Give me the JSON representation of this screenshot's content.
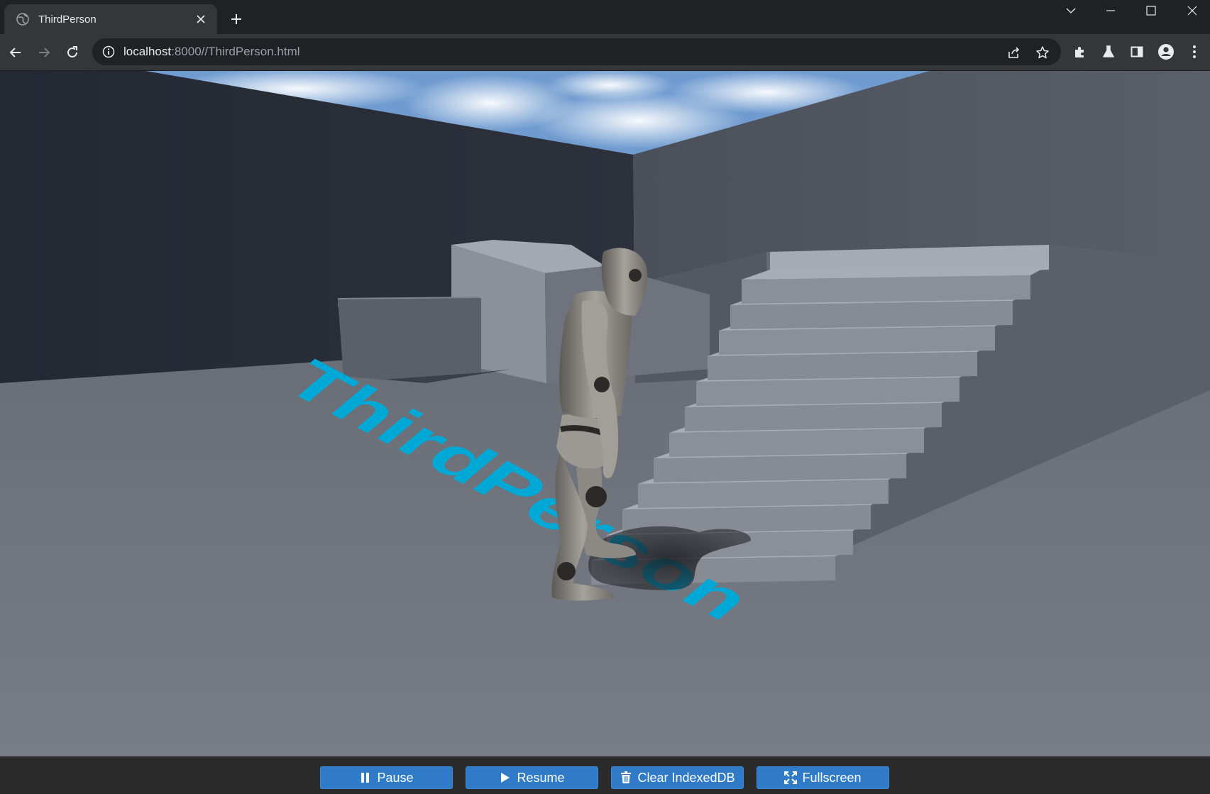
{
  "browser": {
    "tab": {
      "title": "ThirdPerson",
      "favicon": "globe-icon"
    },
    "url": {
      "host": "localhost",
      "rest": ":8000//ThirdPerson.html"
    },
    "colors": {
      "frame": "#202124",
      "toolbar": "#35363a",
      "omnibox": "#202124",
      "text": "#e8eaed",
      "muted": "#9aa0a6"
    }
  },
  "scene": {
    "floor_text": "ThirdPerson",
    "floor_text_color": "#00a8d6",
    "sky_color": "#6f9bd0"
  },
  "controls": {
    "pause_label": "Pause",
    "resume_label": "Resume",
    "clear_label": "Clear IndexedDB",
    "fullscreen_label": "Fullscreen",
    "button_color": "#2f7bc8"
  }
}
